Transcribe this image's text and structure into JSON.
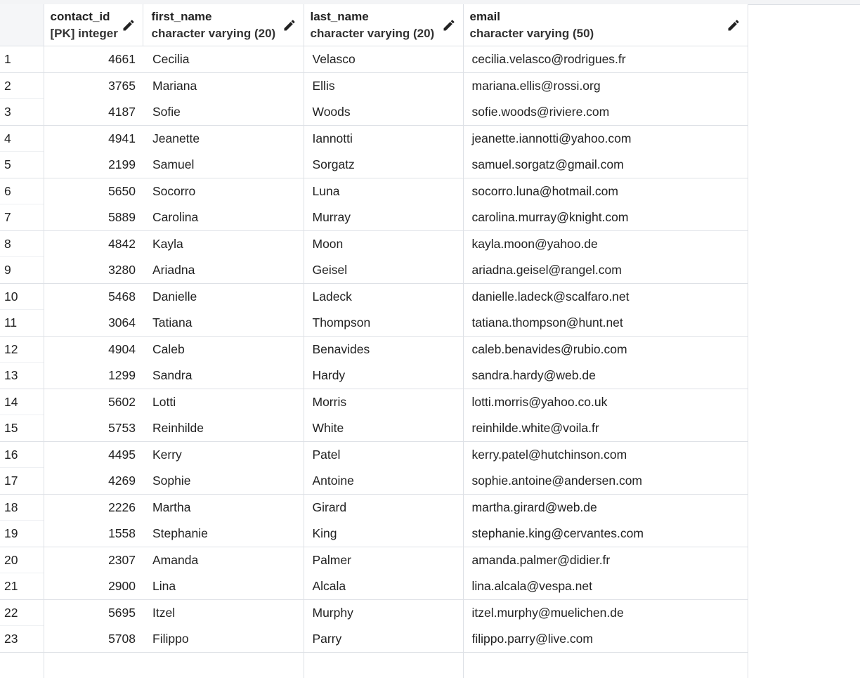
{
  "columns": [
    {
      "name": "contact_id",
      "type": "[PK] integer"
    },
    {
      "name": "first_name",
      "type": "character varying (20)"
    },
    {
      "name": "last_name",
      "type": "character varying (20)"
    },
    {
      "name": "email",
      "type": "character varying (50)"
    }
  ],
  "icons": {
    "edit": "pencil-icon"
  },
  "rows": [
    {
      "n": "1",
      "contact_id": "4661",
      "first_name": "Cecilia",
      "last_name": "Velasco",
      "email": "cecilia.velasco@rodrigues.fr"
    },
    {
      "n": "2",
      "contact_id": "3765",
      "first_name": "Mariana",
      "last_name": "Ellis",
      "email": "mariana.ellis@rossi.org"
    },
    {
      "n": "3",
      "contact_id": "4187",
      "first_name": "Sofie",
      "last_name": "Woods",
      "email": "sofie.woods@riviere.com"
    },
    {
      "n": "4",
      "contact_id": "4941",
      "first_name": "Jeanette",
      "last_name": "Iannotti",
      "email": "jeanette.iannotti@yahoo.com"
    },
    {
      "n": "5",
      "contact_id": "2199",
      "first_name": "Samuel",
      "last_name": "Sorgatz",
      "email": "samuel.sorgatz@gmail.com"
    },
    {
      "n": "6",
      "contact_id": "5650",
      "first_name": "Socorro",
      "last_name": "Luna",
      "email": "socorro.luna@hotmail.com"
    },
    {
      "n": "7",
      "contact_id": "5889",
      "first_name": "Carolina",
      "last_name": "Murray",
      "email": "carolina.murray@knight.com"
    },
    {
      "n": "8",
      "contact_id": "4842",
      "first_name": "Kayla",
      "last_name": "Moon",
      "email": "kayla.moon@yahoo.de"
    },
    {
      "n": "9",
      "contact_id": "3280",
      "first_name": "Ariadna",
      "last_name": "Geisel",
      "email": "ariadna.geisel@rangel.com"
    },
    {
      "n": "10",
      "contact_id": "5468",
      "first_name": "Danielle",
      "last_name": "Ladeck",
      "email": "danielle.ladeck@scalfaro.net"
    },
    {
      "n": "11",
      "contact_id": "3064",
      "first_name": "Tatiana",
      "last_name": "Thompson",
      "email": "tatiana.thompson@hunt.net"
    },
    {
      "n": "12",
      "contact_id": "4904",
      "first_name": "Caleb",
      "last_name": "Benavides",
      "email": "caleb.benavides@rubio.com"
    },
    {
      "n": "13",
      "contact_id": "1299",
      "first_name": "Sandra",
      "last_name": "Hardy",
      "email": "sandra.hardy@web.de"
    },
    {
      "n": "14",
      "contact_id": "5602",
      "first_name": "Lotti",
      "last_name": "Morris",
      "email": "lotti.morris@yahoo.co.uk"
    },
    {
      "n": "15",
      "contact_id": "5753",
      "first_name": "Reinhilde",
      "last_name": "White",
      "email": "reinhilde.white@voila.fr"
    },
    {
      "n": "16",
      "contact_id": "4495",
      "first_name": "Kerry",
      "last_name": "Patel",
      "email": "kerry.patel@hutchinson.com"
    },
    {
      "n": "17",
      "contact_id": "4269",
      "first_name": "Sophie",
      "last_name": "Antoine",
      "email": "sophie.antoine@andersen.com"
    },
    {
      "n": "18",
      "contact_id": "2226",
      "first_name": "Martha",
      "last_name": "Girard",
      "email": "martha.girard@web.de"
    },
    {
      "n": "19",
      "contact_id": "1558",
      "first_name": "Stephanie",
      "last_name": "King",
      "email": "stephanie.king@cervantes.com"
    },
    {
      "n": "20",
      "contact_id": "2307",
      "first_name": "Amanda",
      "last_name": "Palmer",
      "email": "amanda.palmer@didier.fr"
    },
    {
      "n": "21",
      "contact_id": "2900",
      "first_name": "Lina",
      "last_name": "Alcala",
      "email": "lina.alcala@vespa.net"
    },
    {
      "n": "22",
      "contact_id": "5695",
      "first_name": "Itzel",
      "last_name": "Murphy",
      "email": "itzel.murphy@muelichen.de"
    },
    {
      "n": "23",
      "contact_id": "5708",
      "first_name": "Filippo",
      "last_name": "Parry",
      "email": "filippo.parry@live.com"
    }
  ]
}
